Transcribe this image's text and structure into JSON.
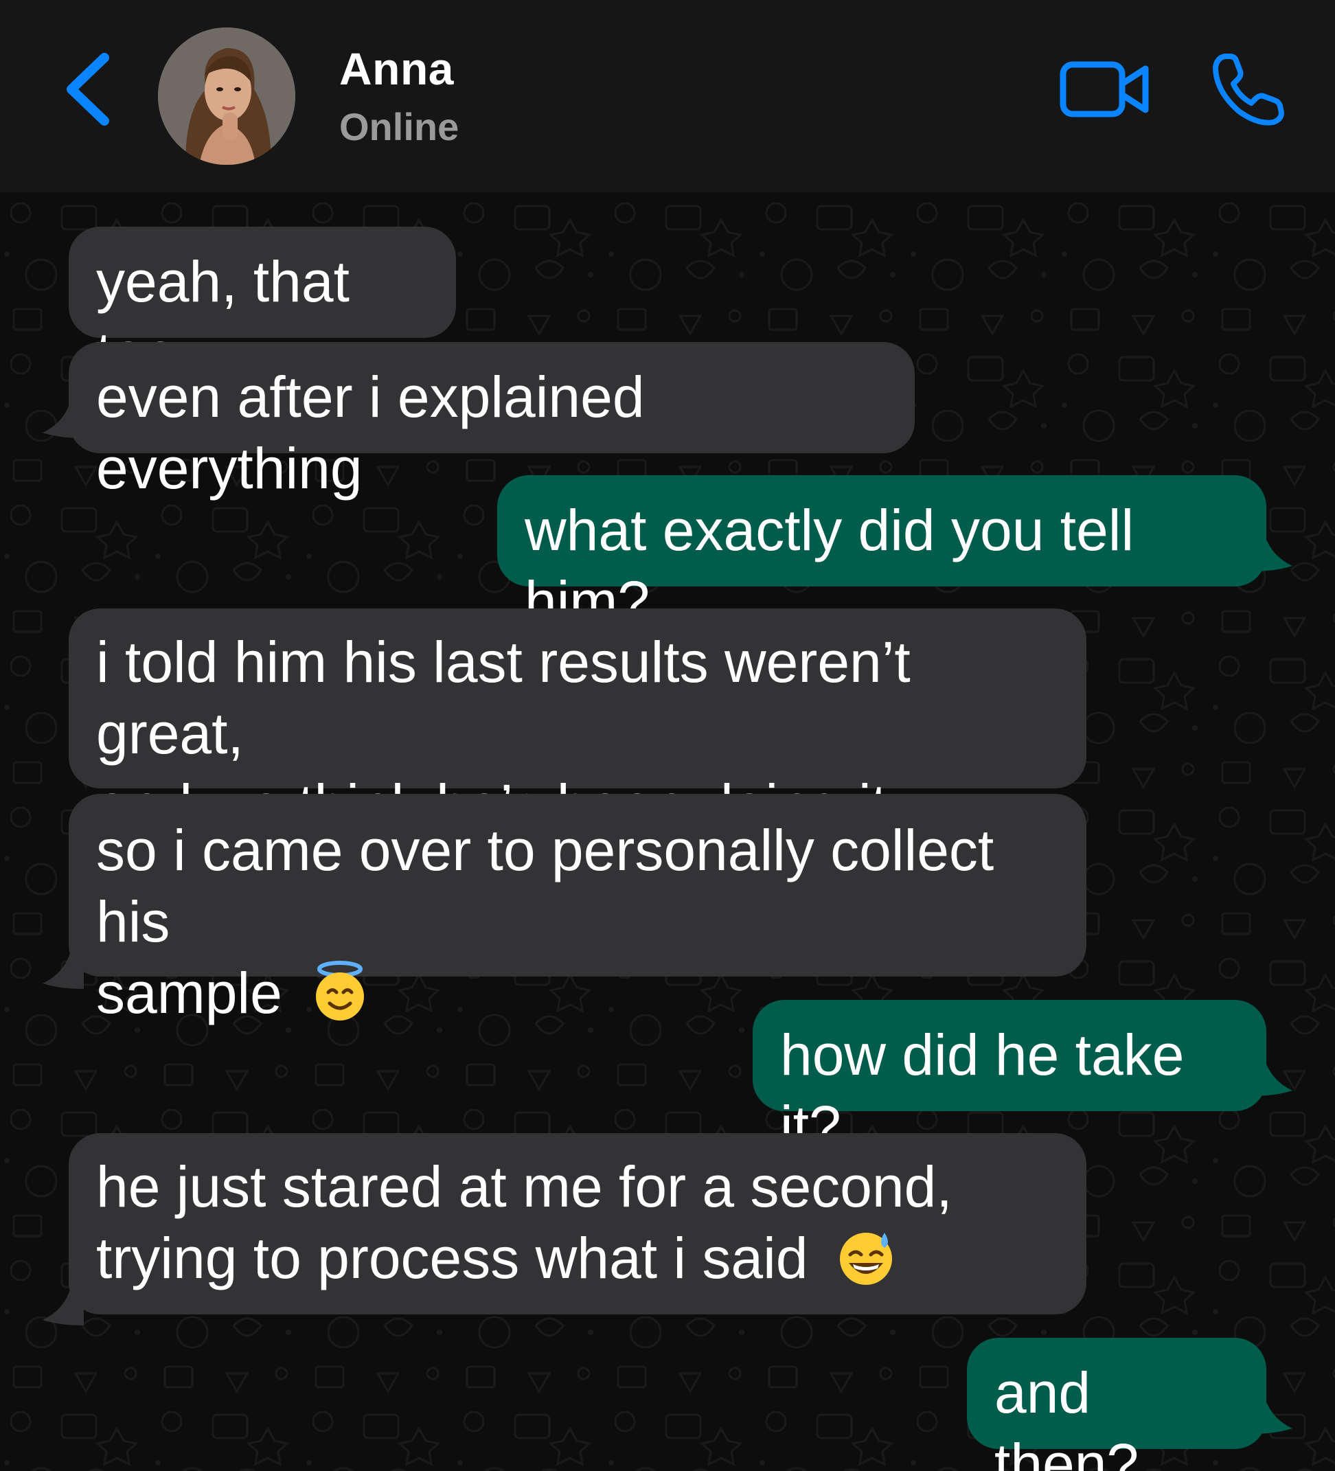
{
  "header": {
    "contact_name": "Anna",
    "contact_status": "Online",
    "back_icon": "chevron-left-icon",
    "video_icon": "video-camera-icon",
    "call_icon": "phone-icon",
    "accent_color": "#0a84ff"
  },
  "messages": [
    {
      "direction": "incoming",
      "text": "yeah, that too"
    },
    {
      "direction": "incoming",
      "text": "even after i explained everything"
    },
    {
      "direction": "outgoing",
      "text": "what exactly did you tell him?"
    },
    {
      "direction": "incoming",
      "line1": "i told him his last results weren’t great,",
      "line2": "and we think he’s been doing it wrong"
    },
    {
      "direction": "incoming",
      "line1": "so i came over to personally collect his",
      "line2": "sample",
      "emoji": "smiling-face-with-halo"
    },
    {
      "direction": "outgoing",
      "text": "how did he take it?"
    },
    {
      "direction": "incoming",
      "line1": "he just stared at me for a second,",
      "line2": "trying to process what i said",
      "emoji": "grinning-face-with-sweat"
    },
    {
      "direction": "outgoing",
      "text": "and then?"
    }
  ],
  "colors": {
    "incoming_bubble": "#333335",
    "outgoing_bubble": "#005c4b",
    "header_bg": "#161616"
  }
}
